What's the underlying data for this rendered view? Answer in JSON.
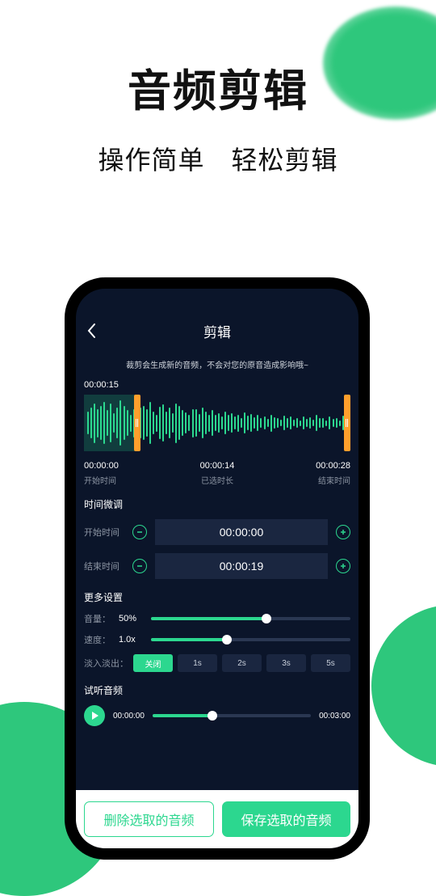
{
  "page": {
    "title": "音频剪辑",
    "subtitle": "操作简单　轻松剪辑"
  },
  "screen": {
    "title": "剪辑",
    "info": "裁剪会生成新的音频，不会对您的原音造成影响哦~",
    "total_time": "00:00:15",
    "times": {
      "start": "00:00:00",
      "selected": "00:00:14",
      "end": "00:00:28",
      "start_label": "开始时间",
      "selected_label": "已选时长",
      "end_label": "结束时间"
    },
    "fine_adjust_title": "时间微调",
    "adjust": {
      "start_label": "开始时间",
      "start_value": "00:00:00",
      "end_label": "结束时间",
      "end_value": "00:00:19"
    },
    "more_settings_title": "更多设置",
    "volume": {
      "label": "音量：",
      "value": "50%",
      "percent": 58
    },
    "speed": {
      "label": "速度：",
      "value": "1.0x",
      "percent": 38
    },
    "fade": {
      "label": "淡入淡出：",
      "options": [
        "关闭",
        "1s",
        "2s",
        "3s",
        "5s"
      ],
      "active_index": 0
    },
    "preview": {
      "title": "试听音频",
      "current": "00:00:00",
      "total": "00:03:00",
      "percent": 38
    }
  },
  "actions": {
    "delete": "删除选取的音频",
    "save": "保存选取的音频"
  }
}
